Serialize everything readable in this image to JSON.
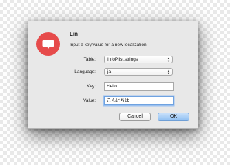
{
  "dialog": {
    "title": "Lin",
    "message": "Input a key/value for a new localization.",
    "icon": "speech-bubble-icon",
    "accent_color": "#e64b4b"
  },
  "fields": {
    "table_label": "Table:",
    "table_value": "InfoPlist.strings",
    "language_label": "Language:",
    "language_value": "ja",
    "key_label": "Key:",
    "key_value": "Hello",
    "value_label": "Value:",
    "value_value": "こんにちは"
  },
  "buttons": {
    "cancel": "Cancel",
    "ok": "OK"
  }
}
